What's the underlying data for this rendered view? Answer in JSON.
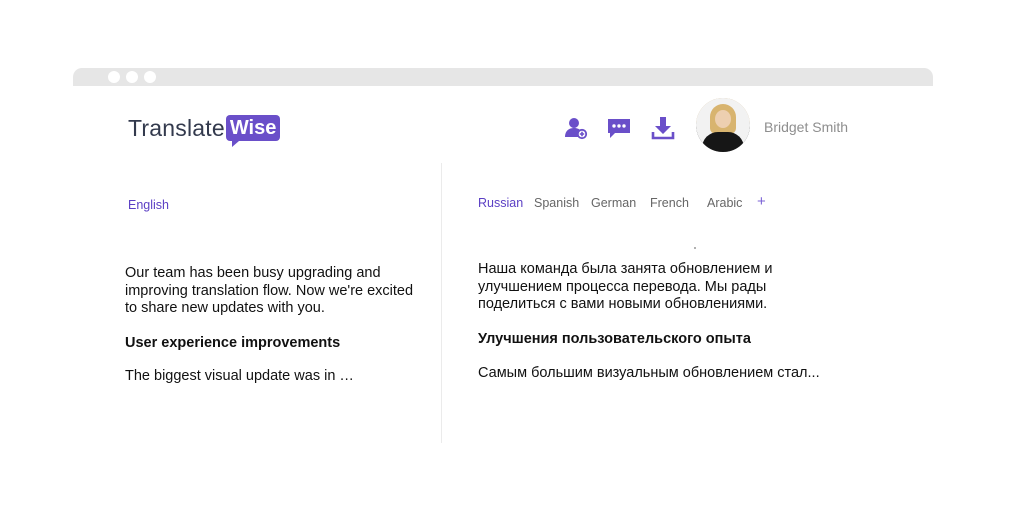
{
  "logo": {
    "part1": "Translate",
    "part2": "Wise"
  },
  "header": {
    "icons": [
      "add-user-icon",
      "chat-icon",
      "download-icon"
    ],
    "user_name": "Bridget Smith"
  },
  "source": {
    "language": "English",
    "paragraph": "Our team has been busy upgrading and improving translation flow. Now we're excited to share new updates with you.",
    "heading": "User experience improvements",
    "tail": "The biggest visual update was in …"
  },
  "target": {
    "tabs": [
      "Russian",
      "Spanish",
      "German",
      "French",
      "Arabic"
    ],
    "active_tab": "Russian",
    "add_label": "+",
    "paragraph": "Наша команда была занята обновлением и улучшением процесса перевода. Мы рады поделиться с вами новыми обновлениями.",
    "heading": "Улучшения пользовательского опыта",
    "tail": "Самым большим визуальным обновлением стал..."
  },
  "colors": {
    "accent": "#5b3fc4",
    "logo_badge": "#6a4fc9",
    "window_bar": "#e6e6e6"
  }
}
